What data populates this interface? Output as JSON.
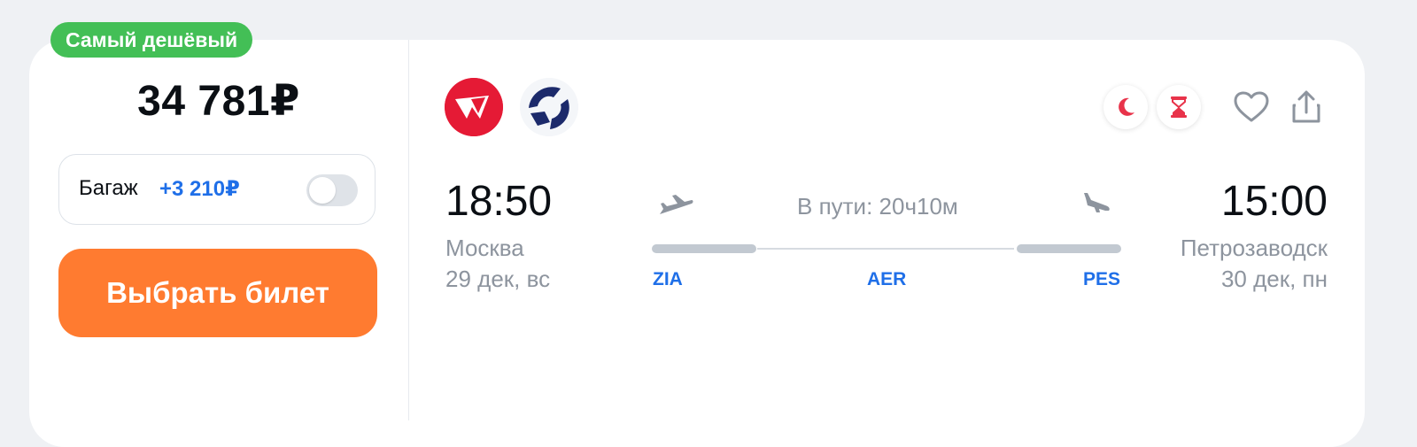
{
  "badge": "Самый дешёвый",
  "price": "34 781₽",
  "baggage": {
    "label": "Багаж",
    "price": "+3 210₽",
    "enabled": false
  },
  "select_button": "Выбрать билет",
  "airlines": [
    "airline-logo-red",
    "airline-logo-blue"
  ],
  "icons": [
    "moon-icon",
    "hourglass-icon",
    "heart-icon",
    "share-icon"
  ],
  "flight": {
    "departure": {
      "time": "18:50",
      "city": "Москва",
      "date": "29 дек, вс"
    },
    "arrival": {
      "time": "15:00",
      "city": "Петрозаводск",
      "date": "30 дек, пн"
    },
    "duration": "В пути: 20ч10м",
    "airports": [
      "ZIA",
      "AER",
      "PES"
    ]
  },
  "colors": {
    "badge": "#43bf56",
    "accent_blue": "#1f6fe8",
    "button": "#ff7b30",
    "icon_red": "#e8334a"
  }
}
